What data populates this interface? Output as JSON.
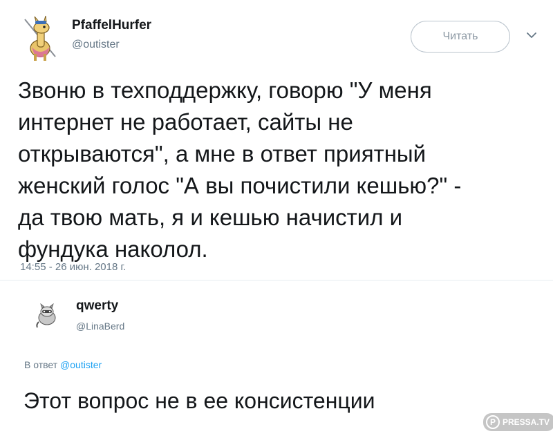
{
  "tweet": {
    "author_name": "PfaffelHurfer",
    "author_handle": "@outister",
    "follow_label": "Читать",
    "text": "Звоню в техподдержку, говорю \"У меня\nинтернет не работает, сайты не\nоткрываются\", а мне в ответ приятный\nженский голос \"А вы почистили кешью?\" -\nда твою мать, я и кешью начистил и\nфундука наколол.",
    "timestamp": "14:55 - 26 июн. 2018 г.",
    "avatar_icon": "llama-avatar-icon",
    "menu_icon": "chevron-down-icon"
  },
  "reply": {
    "author_name": "qwerty",
    "author_handle": "@LinaBerd",
    "reply_prefix": "В ответ",
    "reply_mention": "@outister",
    "text": "Этот вопрос не в ее консистенции",
    "avatar_icon": "raccoon-avatar-icon"
  },
  "watermark": {
    "logo_letter": "P",
    "text": "PRESSA.TV"
  },
  "colors": {
    "text": "#14171a",
    "secondary": "#657786",
    "link": "#1da1f2",
    "border": "#e6ecf0"
  }
}
